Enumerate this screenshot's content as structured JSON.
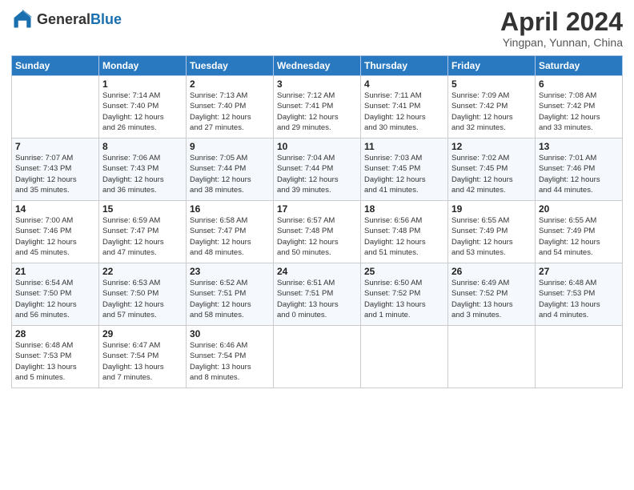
{
  "header": {
    "logo_general": "General",
    "logo_blue": "Blue",
    "title": "April 2024",
    "subtitle": "Yingpan, Yunnan, China"
  },
  "weekdays": [
    "Sunday",
    "Monday",
    "Tuesday",
    "Wednesday",
    "Thursday",
    "Friday",
    "Saturday"
  ],
  "weeks": [
    [
      {
        "day": "",
        "info": ""
      },
      {
        "day": "1",
        "info": "Sunrise: 7:14 AM\nSunset: 7:40 PM\nDaylight: 12 hours\nand 26 minutes."
      },
      {
        "day": "2",
        "info": "Sunrise: 7:13 AM\nSunset: 7:40 PM\nDaylight: 12 hours\nand 27 minutes."
      },
      {
        "day": "3",
        "info": "Sunrise: 7:12 AM\nSunset: 7:41 PM\nDaylight: 12 hours\nand 29 minutes."
      },
      {
        "day": "4",
        "info": "Sunrise: 7:11 AM\nSunset: 7:41 PM\nDaylight: 12 hours\nand 30 minutes."
      },
      {
        "day": "5",
        "info": "Sunrise: 7:09 AM\nSunset: 7:42 PM\nDaylight: 12 hours\nand 32 minutes."
      },
      {
        "day": "6",
        "info": "Sunrise: 7:08 AM\nSunset: 7:42 PM\nDaylight: 12 hours\nand 33 minutes."
      }
    ],
    [
      {
        "day": "7",
        "info": "Sunrise: 7:07 AM\nSunset: 7:43 PM\nDaylight: 12 hours\nand 35 minutes."
      },
      {
        "day": "8",
        "info": "Sunrise: 7:06 AM\nSunset: 7:43 PM\nDaylight: 12 hours\nand 36 minutes."
      },
      {
        "day": "9",
        "info": "Sunrise: 7:05 AM\nSunset: 7:44 PM\nDaylight: 12 hours\nand 38 minutes."
      },
      {
        "day": "10",
        "info": "Sunrise: 7:04 AM\nSunset: 7:44 PM\nDaylight: 12 hours\nand 39 minutes."
      },
      {
        "day": "11",
        "info": "Sunrise: 7:03 AM\nSunset: 7:45 PM\nDaylight: 12 hours\nand 41 minutes."
      },
      {
        "day": "12",
        "info": "Sunrise: 7:02 AM\nSunset: 7:45 PM\nDaylight: 12 hours\nand 42 minutes."
      },
      {
        "day": "13",
        "info": "Sunrise: 7:01 AM\nSunset: 7:46 PM\nDaylight: 12 hours\nand 44 minutes."
      }
    ],
    [
      {
        "day": "14",
        "info": "Sunrise: 7:00 AM\nSunset: 7:46 PM\nDaylight: 12 hours\nand 45 minutes."
      },
      {
        "day": "15",
        "info": "Sunrise: 6:59 AM\nSunset: 7:47 PM\nDaylight: 12 hours\nand 47 minutes."
      },
      {
        "day": "16",
        "info": "Sunrise: 6:58 AM\nSunset: 7:47 PM\nDaylight: 12 hours\nand 48 minutes."
      },
      {
        "day": "17",
        "info": "Sunrise: 6:57 AM\nSunset: 7:48 PM\nDaylight: 12 hours\nand 50 minutes."
      },
      {
        "day": "18",
        "info": "Sunrise: 6:56 AM\nSunset: 7:48 PM\nDaylight: 12 hours\nand 51 minutes."
      },
      {
        "day": "19",
        "info": "Sunrise: 6:55 AM\nSunset: 7:49 PM\nDaylight: 12 hours\nand 53 minutes."
      },
      {
        "day": "20",
        "info": "Sunrise: 6:55 AM\nSunset: 7:49 PM\nDaylight: 12 hours\nand 54 minutes."
      }
    ],
    [
      {
        "day": "21",
        "info": "Sunrise: 6:54 AM\nSunset: 7:50 PM\nDaylight: 12 hours\nand 56 minutes."
      },
      {
        "day": "22",
        "info": "Sunrise: 6:53 AM\nSunset: 7:50 PM\nDaylight: 12 hours\nand 57 minutes."
      },
      {
        "day": "23",
        "info": "Sunrise: 6:52 AM\nSunset: 7:51 PM\nDaylight: 12 hours\nand 58 minutes."
      },
      {
        "day": "24",
        "info": "Sunrise: 6:51 AM\nSunset: 7:51 PM\nDaylight: 13 hours\nand 0 minutes."
      },
      {
        "day": "25",
        "info": "Sunrise: 6:50 AM\nSunset: 7:52 PM\nDaylight: 13 hours\nand 1 minute."
      },
      {
        "day": "26",
        "info": "Sunrise: 6:49 AM\nSunset: 7:52 PM\nDaylight: 13 hours\nand 3 minutes."
      },
      {
        "day": "27",
        "info": "Sunrise: 6:48 AM\nSunset: 7:53 PM\nDaylight: 13 hours\nand 4 minutes."
      }
    ],
    [
      {
        "day": "28",
        "info": "Sunrise: 6:48 AM\nSunset: 7:53 PM\nDaylight: 13 hours\nand 5 minutes."
      },
      {
        "day": "29",
        "info": "Sunrise: 6:47 AM\nSunset: 7:54 PM\nDaylight: 13 hours\nand 7 minutes."
      },
      {
        "day": "30",
        "info": "Sunrise: 6:46 AM\nSunset: 7:54 PM\nDaylight: 13 hours\nand 8 minutes."
      },
      {
        "day": "",
        "info": ""
      },
      {
        "day": "",
        "info": ""
      },
      {
        "day": "",
        "info": ""
      },
      {
        "day": "",
        "info": ""
      }
    ]
  ]
}
